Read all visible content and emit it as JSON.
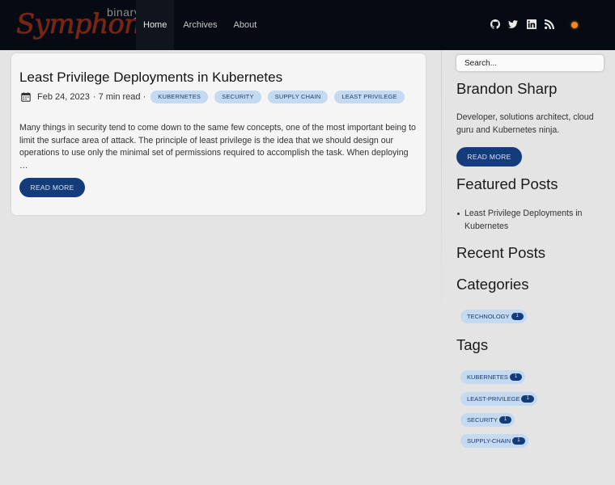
{
  "logo": {
    "sub": "binary",
    "main": "Symphony"
  },
  "nav": {
    "items": [
      "Home",
      "Archives",
      "About"
    ]
  },
  "social": {
    "icons": [
      "github-icon",
      "twitter-icon",
      "linkedin-icon",
      "rss-icon"
    ]
  },
  "colors": {
    "header_bg": "#060a12",
    "accent": "#143c7a",
    "chip_bg": "#c3daf0",
    "toggle": "#f08a24"
  },
  "post": {
    "title": "Least Privilege Deployments in Kubernetes",
    "date": "Feb 24, 2023",
    "read_time": "· 7 min read ·",
    "tags": [
      "Kubernetes",
      "Security",
      "Supply Chain",
      "Least Privilege"
    ],
    "excerpt": "Many things in security tend to come down to the same few concepts, one of the most important being to limit the surface area of attack. The principle of least privilege is the idea that we should design our operations to use only the minimal set of permissions required to accomplish the task. When deploying …",
    "read_more": "Read More"
  },
  "sidebar": {
    "search_placeholder": "Search...",
    "author": "Brandon Sharp",
    "bio": "Developer, solutions architect, cloud guru and Kubernetes ninja.",
    "read_more": "Read More",
    "featured_heading": "Featured Posts",
    "featured": [
      "Least Privilege Deployments in Kubernetes"
    ],
    "recent_heading": "Recent Posts",
    "categories_heading": "Categories",
    "categories": [
      {
        "name": "Technology",
        "count": "1"
      }
    ],
    "tags_heading": "Tags",
    "tags": [
      {
        "name": "Kubernetes",
        "count": "1"
      },
      {
        "name": "Least-Privilege",
        "count": "1"
      },
      {
        "name": "Security",
        "count": "1"
      },
      {
        "name": "Supply-Chain",
        "count": "1"
      }
    ]
  }
}
